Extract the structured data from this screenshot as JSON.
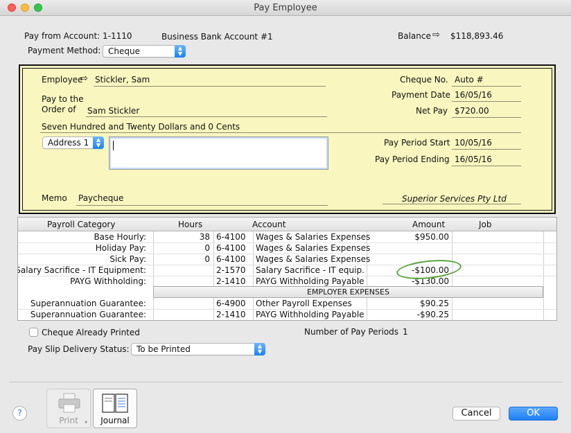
{
  "window": {
    "title": "Pay Employee"
  },
  "account": {
    "label": "Pay from Account:",
    "number": "1-1110",
    "name": "Business Bank Account #1",
    "balance_label": "Balance",
    "balance": "$118,893.46"
  },
  "payment_method": {
    "label": "Payment Method:",
    "value": "Cheque"
  },
  "cheque": {
    "employee_label": "Employee",
    "employee": "Stickler, Sam",
    "pay_to_label_1": "Pay to the",
    "pay_to_label_2": "Order of",
    "pay_to": "Sam Stickler",
    "amount_words": "Seven Hundred and Twenty Dollars and 0 Cents",
    "address_select": "Address 1",
    "address_text": "",
    "memo_label": "Memo",
    "memo": "Paycheque",
    "company": "Superior Services Pty Ltd",
    "cheque_no_label": "Cheque No.",
    "cheque_no": "Auto #",
    "payment_date_label": "Payment Date",
    "payment_date": "16/05/16",
    "net_pay_label": "Net Pay",
    "net_pay": "$720.00",
    "period_start_label": "Pay Period Start",
    "period_start": "10/05/16",
    "period_end_label": "Pay Period Ending",
    "period_end": "16/05/16"
  },
  "grid": {
    "headers": {
      "category": "Payroll Category",
      "hours": "Hours",
      "account": "Account",
      "amount": "Amount",
      "job": "Job"
    },
    "rows": [
      {
        "category": "Base Hourly:",
        "hours": "38",
        "acct_no": "6-4100",
        "acct_name": "Wages & Salaries Expenses",
        "amount": "$950.00"
      },
      {
        "category": "Holiday Pay:",
        "hours": "0",
        "acct_no": "6-4100",
        "acct_name": "Wages & Salaries Expenses",
        "amount": ""
      },
      {
        "category": "Sick Pay:",
        "hours": "0",
        "acct_no": "6-4100",
        "acct_name": "Wages & Salaries Expenses",
        "amount": ""
      },
      {
        "category": "Salary Sacrifice - IT Equipment:",
        "hours": "",
        "acct_no": "2-1570",
        "acct_name": "Salary Sacrifice - IT equip.",
        "amount": "-$100.00"
      },
      {
        "category": "PAYG Withholding:",
        "hours": "",
        "acct_no": "2-1410",
        "acct_name": "PAYG Withholding Payable",
        "amount": "-$130.00"
      }
    ],
    "employer_label": "EMPLOYER EXPENSES",
    "employer_rows": [
      {
        "category": "Superannuation Guarantee:",
        "hours": "",
        "acct_no": "6-4900",
        "acct_name": "Other Payroll Expenses",
        "amount": "$90.25"
      },
      {
        "category": "Superannuation Guarantee:",
        "hours": "",
        "acct_no": "2-1410",
        "acct_name": "PAYG Withholding Payable",
        "amount": "-$90.25"
      }
    ]
  },
  "footer": {
    "cheque_printed_label": "Cheque Already Printed",
    "pay_periods_label": "Number of Pay Periods",
    "pay_periods": "1",
    "delivery_label": "Pay Slip Delivery Status:",
    "delivery_value": "To be Printed",
    "help": "?",
    "print_label": "Print",
    "journal_label": "Journal",
    "cancel_label": "Cancel",
    "ok_label": "OK"
  }
}
